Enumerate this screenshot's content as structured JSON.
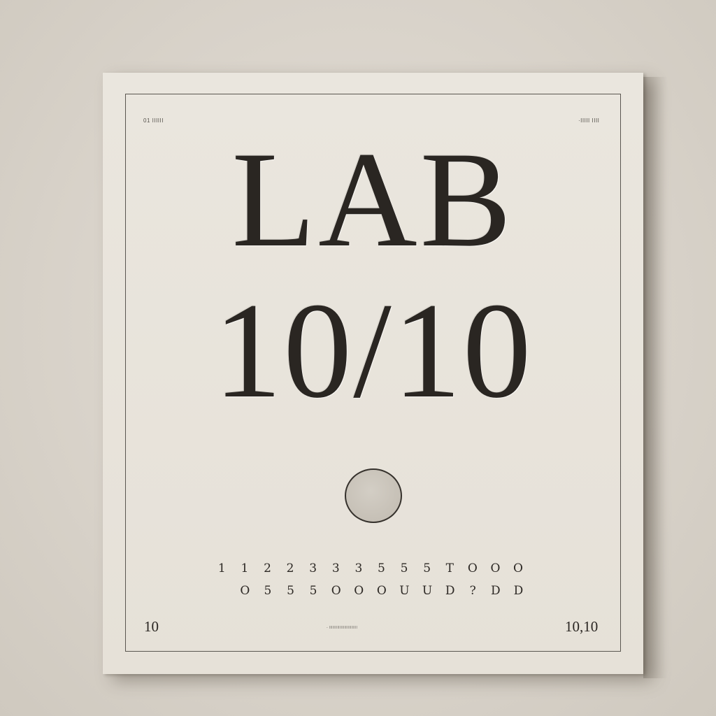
{
  "board": {
    "corner_top_left": "01 IIIIII",
    "corner_top_right": "·IIIII IIII",
    "title_line1": "LAB",
    "title_line2": "10/10",
    "digits_row1": [
      "1",
      "1",
      "2",
      "2",
      "3",
      "3",
      "3",
      "5",
      "5",
      "5",
      "T",
      "O",
      "O",
      "O"
    ],
    "digits_row2": [
      "O",
      "5",
      "5",
      "5",
      "O",
      "O",
      "O",
      "U",
      "U",
      "D",
      "?",
      "D",
      "D"
    ],
    "bottom_left": "10",
    "bottom_center": "- IIIIIIIIIIIIIIIIIIIIIIII",
    "bottom_right": "10,10"
  }
}
